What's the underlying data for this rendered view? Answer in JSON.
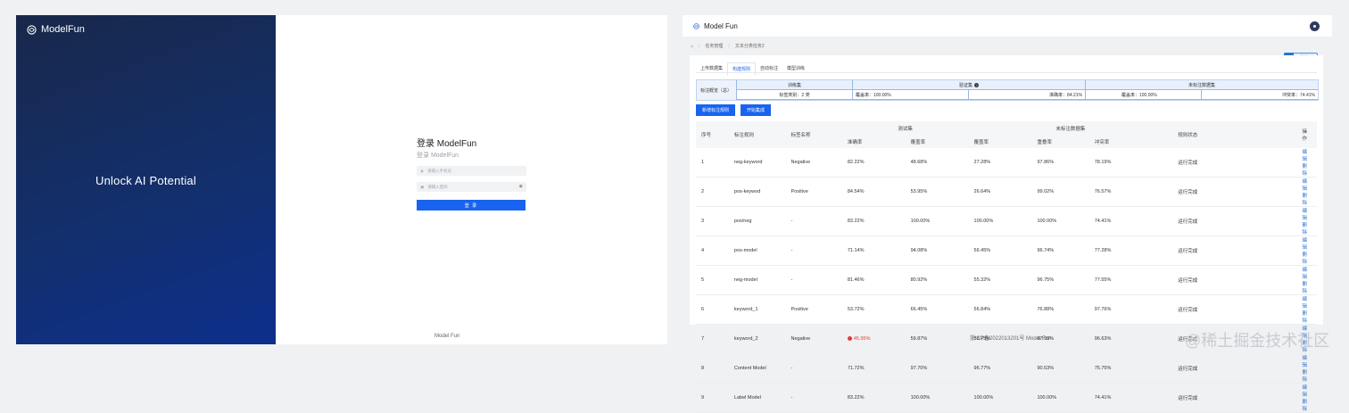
{
  "login_page": {
    "brand": "ModelFun",
    "tagline": "Unlock AI Potential",
    "title": "登录 ModelFun",
    "subtitle": "登录 ModelFun",
    "phone_placeholder": "请输入手机号",
    "password_placeholder": "请输入密码",
    "login_button": "登 录",
    "footer": "Model Fun"
  },
  "app": {
    "brand": "Model Fun",
    "breadcrumb": [
      "任务管理",
      "文本分类任务2"
    ],
    "upload_badge": "视频上传",
    "tabs": [
      "上传数据集",
      "构建规则",
      "自动标注",
      "模型训练"
    ],
    "active_tab": 1,
    "summary": {
      "label": "标注概览（总）",
      "groups": [
        "训练集",
        "验证集",
        "未标注数据集"
      ],
      "cells": [
        "标签类别：2 类",
        "覆盖率：100.00%",
        "准确率：84.21%",
        "覆盖率：100.00%",
        "冲突率：74.41%"
      ]
    },
    "buttons": {
      "new_rule": "新增标注规则",
      "start_integration": "开始集成"
    },
    "table": {
      "headers": {
        "index": "序号",
        "rule": "标注规则",
        "label": "标签名称",
        "test_group": "测试集",
        "unlabeled_group": "未标注数据集",
        "status": "规则状态",
        "ops": "操作"
      },
      "sub_headers": [
        "准确率",
        "覆盖率",
        "覆盖率",
        "重叠率",
        "冲突率"
      ],
      "rows": [
        {
          "idx": "1",
          "rule": "neg-keyword",
          "label": "Negative",
          "acc": "82.22%",
          "cov": "48.68%",
          "ucov": "27.28%",
          "overlap": "97.86%",
          "conflict": "78.19%",
          "status": "运行完成",
          "error": false
        },
        {
          "idx": "2",
          "rule": "pos-keywod",
          "label": "Positive",
          "acc": "84.54%",
          "cov": "53.95%",
          "ucov": "26.64%",
          "overlap": "99.02%",
          "conflict": "76.57%",
          "status": "运行完成",
          "error": false
        },
        {
          "idx": "3",
          "rule": "pos/neg",
          "label": "-",
          "acc": "83.22%",
          "cov": "100.00%",
          "ucov": "100.00%",
          "overlap": "100.00%",
          "conflict": "74.41%",
          "status": "运行完成",
          "error": false
        },
        {
          "idx": "4",
          "rule": "pos-model",
          "label": "-",
          "acc": "71.14%",
          "cov": "94.08%",
          "ucov": "56.45%",
          "overlap": "96.74%",
          "conflict": "77.28%",
          "status": "运行完成",
          "error": false
        },
        {
          "idx": "5",
          "rule": "neg-model",
          "label": "-",
          "acc": "81.46%",
          "cov": "80.92%",
          "ucov": "55.32%",
          "overlap": "96.75%",
          "conflict": "77.55%",
          "status": "运行完成",
          "error": false
        },
        {
          "idx": "6",
          "rule": "keyword_1",
          "label": "Positive",
          "acc": "53.72%",
          "cov": "66.45%",
          "ucov": "56.84%",
          "overlap": "76.88%",
          "conflict": "97.76%",
          "status": "运行完成",
          "error": false
        },
        {
          "idx": "7",
          "rule": "keyword_2",
          "label": "Negative",
          "acc": "45.95%",
          "cov": "59.87%",
          "ucov": "58.73%",
          "overlap": "67.99%",
          "conflict": "96.63%",
          "status": "运行完成",
          "error": true
        },
        {
          "idx": "8",
          "rule": "Content Model",
          "label": "-",
          "acc": "71.72%",
          "cov": "97.70%",
          "ucov": "96.77%",
          "overlap": "90.53%",
          "conflict": "75.75%",
          "status": "运行完成",
          "error": false
        },
        {
          "idx": "9",
          "rule": "Label Model",
          "label": "-",
          "acc": "83.22%",
          "cov": "100.00%",
          "ucov": "100.00%",
          "overlap": "100.00%",
          "conflict": "74.41%",
          "status": "运行完成",
          "error": false
        }
      ],
      "op_edit": "编辑",
      "op_delete": "删除"
    },
    "footer": "浙ICP备2022013201号 Model Fun"
  },
  "watermark": "@稀土掘金技术社区",
  "colors": {
    "primary": "#1864f0",
    "success": "#1aa84b",
    "error": "#e03b3b",
    "hero_dark": "#18284a",
    "hero_blue": "#0d2f8c"
  }
}
